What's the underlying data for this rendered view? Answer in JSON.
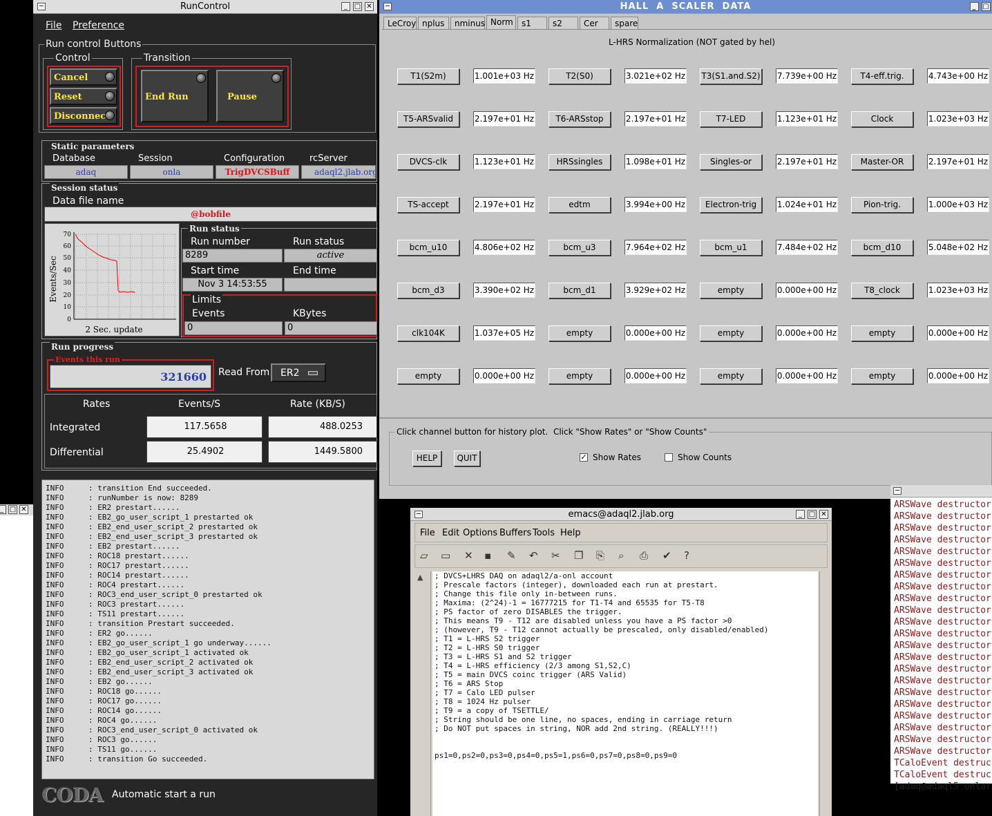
{
  "runcontrol": {
    "title": "RunControl",
    "menu": [
      "File",
      "Preference"
    ],
    "run_control_buttons_label": "Run control Buttons",
    "control_label": "Control",
    "control_buttons": [
      "Cancel",
      "Reset",
      "Disconnect"
    ],
    "transition_label": "Transition",
    "transition_buttons": [
      "End Run",
      "Pause"
    ],
    "static_parameters_label": "Static parameters",
    "static_params": [
      {
        "label": "Database",
        "value": "adaq"
      },
      {
        "label": "Session",
        "value": "onla"
      },
      {
        "label": "Configuration",
        "value": "TrigDVCSBuff"
      },
      {
        "label": "rcServer",
        "value": "adaql2.jlab.org"
      }
    ],
    "session_status_label": "Session status",
    "data_file_label": "Data file name",
    "data_file_value": "@bobfile",
    "graph": {
      "ylabel": "Events/Sec",
      "caption": "2 Sec. update",
      "yticks": [
        "70",
        "60",
        "50",
        "40",
        "30",
        "20",
        "10",
        "0"
      ]
    },
    "run_status_section": "Run status",
    "run_number_label": "Run number",
    "run_number": "8289",
    "run_status_label": "Run status",
    "run_status": "active",
    "start_time_label": "Start time",
    "start_time": "Nov 3 14:53:55",
    "end_time_label": "End time",
    "end_time": "",
    "limits_label": "Limits",
    "events_label": "Events",
    "events_limit": "0",
    "kbytes_label": "KBytes",
    "kbytes_limit": "0",
    "run_progress_label": "Run progress",
    "events_this_run_label": "Events this run",
    "events_this_run": "321660",
    "read_from_label": "Read From:",
    "read_from_value": "ER2",
    "rates_headers": [
      "Rates",
      "Events/S",
      "Rate (KB/S)"
    ],
    "integrated_label": "Integrated",
    "integrated_events": "117.5658",
    "integrated_rate": "488.0253",
    "differential_label": "Differential",
    "differential_events": "25.4902",
    "differential_rate": "1449.5800",
    "log": [
      [
        "INFO",
        ": transition End succeeded."
      ],
      [
        "INFO",
        ": runNumber is now: 8289"
      ],
      [
        "INFO",
        ": ER2 prestart......"
      ],
      [
        "INFO",
        ": EB2_go_user_script_1 prestarted ok"
      ],
      [
        "INFO",
        ": EB2_end_user_script_2 prestarted ok"
      ],
      [
        "INFO",
        ": EB2_end_user_script_3 prestarted ok"
      ],
      [
        "INFO",
        ": EB2 prestart......"
      ],
      [
        "INFO",
        ": ROC18 prestart......"
      ],
      [
        "INFO",
        ": ROC17 prestart......"
      ],
      [
        "INFO",
        ": ROC14 prestart......"
      ],
      [
        "INFO",
        ": ROC4 prestart......"
      ],
      [
        "INFO",
        ": ROC3_end_user_script_0 prestarted ok"
      ],
      [
        "INFO",
        ": ROC3 prestart......"
      ],
      [
        "INFO",
        ": TS11 prestart......"
      ],
      [
        "INFO",
        ": transition Prestart succeeded."
      ],
      [
        "INFO",
        ": ER2 go......"
      ],
      [
        "INFO",
        ": EB2_go_user_script_1 go underway......"
      ],
      [
        "INFO",
        ": EB2_go_user_script_1 activated ok"
      ],
      [
        "INFO",
        ": EB2_end_user_script_2 activated ok"
      ],
      [
        "INFO",
        ": EB2_end_user_script_3 activated ok"
      ],
      [
        "INFO",
        ": EB2 go......"
      ],
      [
        "INFO",
        ": ROC18 go......"
      ],
      [
        "INFO",
        ": ROC17 go......"
      ],
      [
        "INFO",
        ": ROC14 go......"
      ],
      [
        "INFO",
        ": ROC4 go......"
      ],
      [
        "INFO",
        ": ROC3_end_user_script_0 activated ok"
      ],
      [
        "INFO",
        ": ROC3 go......"
      ],
      [
        "INFO",
        ": TS11 go......"
      ],
      [
        "INFO",
        ": transition Go succeeded."
      ]
    ],
    "coda_logo": "CODA",
    "status_bar": "Automatic start a run"
  },
  "scaler": {
    "title": "HALL  A  SCALER  DATA",
    "tabs": [
      "LeCroy",
      "nplus",
      "nminus",
      "Norm",
      "s1",
      "s2",
      "Cer",
      "spare"
    ],
    "active_tab": "Norm",
    "heading": "L-HRS Normalization (NOT gated by hel)",
    "channels": [
      [
        [
          "T1(S2m)",
          "1.001e+03 Hz"
        ],
        [
          "T2(S0)",
          "3.021e+02 Hz"
        ],
        [
          "T3(S1.and.S2)",
          "7.739e+00 Hz"
        ],
        [
          "T4-eff.trig.",
          "4.743e+00 Hz"
        ]
      ],
      [
        [
          "T5-ARSvalid",
          "2.197e+01 Hz"
        ],
        [
          "T6-ARSstop",
          "2.197e+01 Hz"
        ],
        [
          "T7-LED",
          "1.123e+01 Hz"
        ],
        [
          "Clock",
          "1.023e+03 Hz"
        ]
      ],
      [
        [
          "DVCS-clk",
          "1.123e+01 Hz"
        ],
        [
          "HRSsingles",
          "1.098e+01 Hz"
        ],
        [
          "Singles-or",
          "2.197e+01 Hz"
        ],
        [
          "Master-OR",
          "2.197e+01 Hz"
        ]
      ],
      [
        [
          "TS-accept",
          "2.197e+01 Hz"
        ],
        [
          "edtm",
          "3.994e+00 Hz"
        ],
        [
          "Electron-trig",
          "1.024e+01 Hz"
        ],
        [
          "Pion-trig.",
          "1.000e+03 Hz"
        ]
      ],
      [
        [
          "bcm_u10",
          "4.806e+02 Hz"
        ],
        [
          "bcm_u3",
          "7.964e+02 Hz"
        ],
        [
          "bcm_u1",
          "7.484e+02 Hz"
        ],
        [
          "bcm_d10",
          "5.048e+02 Hz"
        ]
      ],
      [
        [
          "bcm_d3",
          "3.390e+02 Hz"
        ],
        [
          "bcm_d1",
          "3.929e+02 Hz"
        ],
        [
          "empty",
          "0.000e+00 Hz"
        ],
        [
          "T8_clock",
          "1.023e+03 Hz"
        ]
      ],
      [
        [
          "clk104K",
          "1.037e+05 Hz"
        ],
        [
          "empty",
          "0.000e+00 Hz"
        ],
        [
          "empty",
          "0.000e+00 Hz"
        ],
        [
          "empty",
          "0.000e+00 Hz"
        ]
      ],
      [
        [
          "empty",
          "0.000e+00 Hz"
        ],
        [
          "empty",
          "0.000e+00 Hz"
        ],
        [
          "empty",
          "0.000e+00 Hz"
        ],
        [
          "empty",
          "0.000e+00 Hz"
        ]
      ]
    ],
    "hint": "Click channel button for history plot.  Click \"Show Rates\" or \"Show Counts\"",
    "help": "HELP",
    "quit": "QUIT",
    "show_rates": "Show Rates",
    "show_rates_checked": true,
    "show_counts": "Show Counts",
    "show_counts_checked": false
  },
  "emacs": {
    "title": "emacs@adaql2.jlab.org",
    "menu": [
      "File",
      "Edit",
      "Options",
      "Buffers",
      "Tools",
      "Help"
    ],
    "toolbar_icons": [
      "new-file-icon",
      "open-folder-icon",
      "close-icon",
      "save-icon",
      "save-as-icon",
      "undo-icon",
      "cut-icon",
      "copy-icon",
      "paste-icon",
      "search-icon",
      "print-icon",
      "customize-icon",
      "help-icon"
    ],
    "lines": [
      "; DVCS+LHRS DAQ on adaql2/a-onl account",
      "; Prescale factors (integer), downloaded each run at prestart.",
      "; Change this file only in-between runs.",
      "; Maxima: (2^24)-1 = 16777215 for T1-T4 and 65535 for T5-T8",
      "; PS factor of zero DISABLES the trigger.",
      "; This means T9 - T12 are disabled unless you have a PS factor >0",
      "; (however, T9 - T12 cannot actually be prescaled, only disabled/enabled)",
      "; T1 = L-HRS S2 trigger",
      "; T2 = L-HRS S0 trigger",
      "; T3 = L-HRS S1 and S2 trigger",
      "; T4 = L-HRS efficiency (2/3 among S1,S2,C)",
      "; T5 = main DVCS coinc trigger (ARS Valid)",
      "; T6 = ARS Stop",
      "; T7 = Calo LED pulser",
      "; T8 = 1024 Hz pulser",
      "; T9 = a copy of TSETTLE/",
      "; String should be one line, no spaces, ending in carriage return",
      "; Do NOT put spaces in string, NOR add 2nd string. (REALLY!!!)",
      "",
      "",
      "ps1=0,ps2=0,ps3=0,ps4=0,ps5=1,ps6=0,ps7=0,ps8=0,ps9=0"
    ]
  },
  "terminal": {
    "lines": [
      "ARSWave destructor",
      "ARSWave destructor",
      "ARSWave destructor",
      "ARSWave destructor",
      "ARSWave destructor",
      "ARSWave destructor",
      "ARSWave destructor",
      "ARSWave destructor",
      "ARSWave destructor",
      "ARSWave destructor",
      "ARSWave destructor",
      "ARSWave destructor",
      "ARSWave destructor",
      "ARSWave destructor",
      "ARSWave destructor",
      "ARSWave destructor",
      "ARSWave destructor",
      "ARSWave destructor",
      "ARSWave destructor",
      "ARSWave destructor",
      "ARSWave destructor",
      "ARSWave destructor",
      "TCaloEvent destruc",
      "TCaloEvent destruc",
      "[adaq@adaql5 onlar"
    ]
  }
}
